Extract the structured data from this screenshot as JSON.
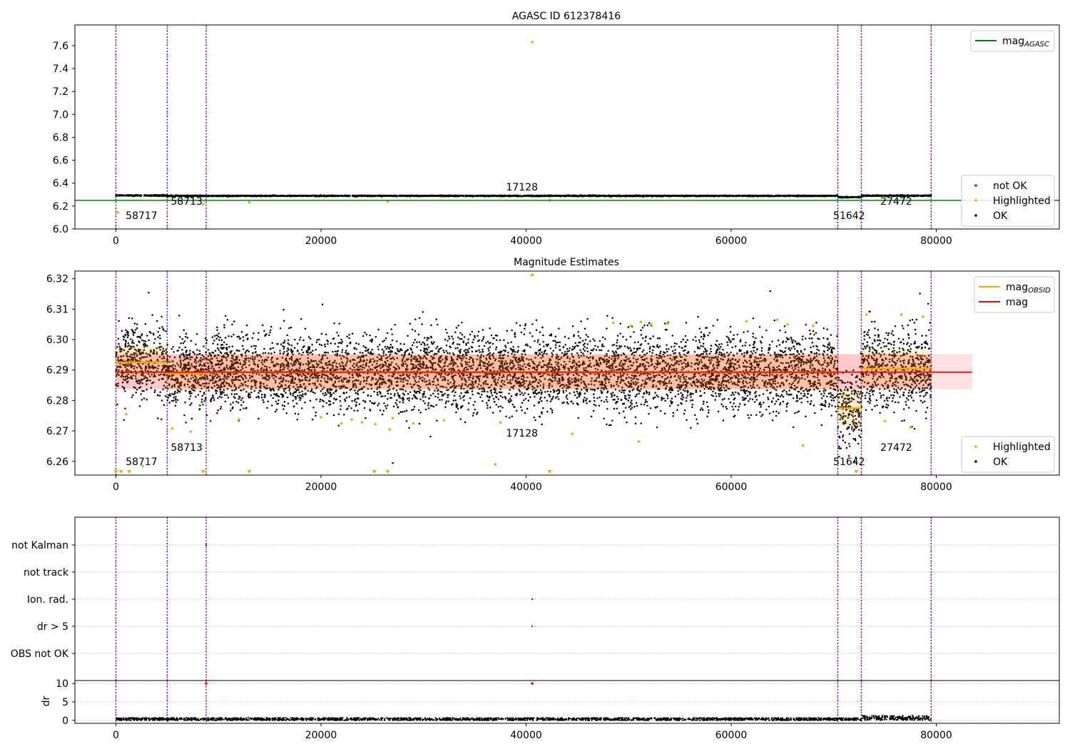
{
  "colors": {
    "ok": "#000000",
    "highlighted": "#ffa500",
    "not_ok": "#ff0000",
    "mag_agasc": "#008000",
    "mag_obsid": "#ffa500",
    "mag": "#ff0000",
    "obs_boundary": "#800080",
    "obs_boundary_alt": "#00008b"
  },
  "obs_boundaries": [
    0,
    5000,
    8800,
    70400,
    72700,
    79500
  ],
  "obsids": [
    {
      "label": "58717",
      "x": 2500
    },
    {
      "label": "58713",
      "x": 6900
    },
    {
      "label": "17128",
      "x": 39600
    },
    {
      "label": "51642",
      "x": 71500
    },
    {
      "label": "27472",
      "x": 76100
    }
  ],
  "chart_data": [
    {
      "type": "scatter",
      "title": "AGASC ID 612378416",
      "xlabel": "",
      "ylabel": "",
      "xlim": [
        -4000,
        92000
      ],
      "ylim": [
        6.0,
        7.78
      ],
      "xticks": [
        0,
        20000,
        40000,
        60000,
        80000
      ],
      "yticks": [
        6.0,
        6.2,
        6.4,
        6.6,
        6.8,
        7.0,
        7.2,
        7.4,
        7.6
      ],
      "legend_top": {
        "position": "top-right",
        "entries": [
          {
            "label": "mag",
            "sub": "AGASC",
            "kind": "line",
            "color": "#008000"
          }
        ]
      },
      "legend_bottom": {
        "position": "bottom-right",
        "entries": [
          {
            "label": "not OK",
            "kind": "dot",
            "color": "#ff0000"
          },
          {
            "label": "Highlighted",
            "kind": "dot",
            "color": "#ffa500"
          },
          {
            "label": "OK",
            "kind": "dot",
            "color": "#000000"
          }
        ]
      },
      "mag_agasc": 6.25,
      "ok_bands": [
        {
          "x": [
            0,
            5000
          ],
          "center": 6.2925,
          "spread": 0.004
        },
        {
          "x": [
            5000,
            8800
          ],
          "center": 6.289,
          "spread": 0.004
        },
        {
          "x": [
            8800,
            70400
          ],
          "center": 6.289,
          "spread": 0.0035
        },
        {
          "x": [
            70400,
            72700
          ],
          "center": 6.2775,
          "spread": 0.004
        },
        {
          "x": [
            72700,
            79500
          ],
          "center": 6.2905,
          "spread": 0.004
        }
      ],
      "highlighted_points": [
        [
          200,
          6.145
        ],
        [
          8500,
          6.215
        ],
        [
          13000,
          6.232
        ],
        [
          26500,
          6.238
        ],
        [
          42300,
          6.25
        ],
        [
          40600,
          7.63
        ]
      ]
    },
    {
      "type": "scatter",
      "title": "Magnitude Estimates",
      "xlabel": "",
      "ylabel": "",
      "xlim": [
        -4000,
        92000
      ],
      "ylim": [
        6.2555,
        6.3225
      ],
      "xticks": [
        0,
        20000,
        40000,
        60000,
        80000
      ],
      "yticks": [
        6.26,
        6.27,
        6.28,
        6.29,
        6.3,
        6.31,
        6.32
      ],
      "yticklabels": [
        "6.26",
        "6.27",
        "6.28",
        "6.29",
        "6.30",
        "6.31",
        "6.32"
      ],
      "legend_top": {
        "position": "top-right",
        "entries": [
          {
            "label": "mag",
            "sub": "OBSID",
            "kind": "line",
            "color": "#ffa500"
          },
          {
            "label": "mag",
            "kind": "line",
            "color": "#ff0000"
          }
        ]
      },
      "legend_bottom": {
        "position": "bottom-right",
        "entries": [
          {
            "label": "Highlighted",
            "kind": "dot",
            "color": "#ffa500"
          },
          {
            "label": "OK",
            "kind": "dot",
            "color": "#000000"
          }
        ]
      },
      "mag": 6.2893,
      "mag_band": [
        6.2837,
        6.2952
      ],
      "mag_band_x": [
        0,
        83500
      ],
      "mag_obsid": [
        {
          "x": [
            0,
            5000
          ],
          "value": 6.2925,
          "band": [
            6.287,
            6.298
          ]
        },
        {
          "x": [
            5000,
            8800
          ],
          "value": 6.2888,
          "band": [
            6.2835,
            6.294
          ]
        },
        {
          "x": [
            8800,
            70400
          ],
          "value": 6.2893,
          "band": [
            6.2837,
            6.295
          ]
        },
        {
          "x": [
            70400,
            72700
          ],
          "value": 6.2775,
          "band": [
            6.2715,
            6.2835
          ]
        },
        {
          "x": [
            72700,
            79500
          ],
          "value": 6.2905,
          "band": [
            6.2845,
            6.2962
          ]
        }
      ],
      "highlighted_points": [
        [
          1000,
          6.2755
        ],
        [
          5500,
          6.2708
        ],
        [
          7300,
          6.2698
        ],
        [
          12000,
          6.2738
        ],
        [
          20000,
          6.2745
        ],
        [
          22000,
          6.2725
        ],
        [
          23000,
          6.2738
        ],
        [
          24000,
          6.2728
        ],
        [
          25300,
          6.2722
        ],
        [
          26700,
          6.2705
        ],
        [
          27000,
          6.2742
        ],
        [
          29000,
          6.2725
        ],
        [
          32000,
          6.2735
        ],
        [
          37500,
          6.2728
        ],
        [
          37000,
          6.259
        ],
        [
          44500,
          6.269
        ],
        [
          51000,
          6.2665
        ],
        [
          67000,
          6.2652
        ],
        [
          75000,
          6.2732
        ],
        [
          77500,
          6.2712
        ],
        [
          2600,
          6.2585
        ],
        [
          48500,
          6.3055
        ],
        [
          50200,
          6.3045
        ],
        [
          51200,
          6.3058
        ],
        [
          52200,
          6.305
        ],
        [
          53800,
          6.3052
        ],
        [
          61500,
          6.306
        ],
        [
          64500,
          6.3065
        ],
        [
          65500,
          6.305
        ],
        [
          68000,
          6.3045
        ],
        [
          73200,
          6.3082
        ],
        [
          76600,
          6.3082
        ],
        [
          78700,
          6.3075
        ]
      ],
      "lower_markers": [
        0,
        500,
        1300,
        8500,
        13000,
        25200,
        26500,
        42300,
        72200
      ],
      "upper_markers": [
        40600
      ]
    },
    {
      "type": "scatter",
      "title": "",
      "xlabel": "",
      "ylabel": "",
      "xlim": [
        -4000,
        92000
      ],
      "categories": [
        "not Kalman",
        "not track",
        "Ion. rad.",
        "dr > 5",
        "OBS not OK"
      ],
      "flag_points": [
        {
          "category": "not Kalman",
          "x": 8800
        },
        {
          "category": "Ion. rad.",
          "x": 40600
        },
        {
          "category": "dr > 5",
          "x": 40600
        }
      ]
    },
    {
      "type": "scatter",
      "title": "",
      "xlabel": "",
      "ylabel": "dr",
      "xlim": [
        -4000,
        92000
      ],
      "ylim": [
        -0.8,
        10.8
      ],
      "xticks": [
        0,
        20000,
        40000,
        60000,
        80000
      ],
      "yticks": [
        0,
        5,
        10
      ],
      "ok_range": [
        [
          0,
          72700,
          0.0,
          0.7
        ],
        [
          72700,
          79500,
          0.0,
          1.3
        ]
      ],
      "not_ok_points": [
        [
          8800,
          10.0
        ],
        [
          40600,
          10.0
        ]
      ]
    }
  ],
  "xtick_labels": [
    "0",
    "20000",
    "40000",
    "60000",
    "80000"
  ],
  "ytick_labels_top": [
    "6.0",
    "6.2",
    "6.4",
    "6.6",
    "6.8",
    "7.0",
    "7.2",
    "7.4",
    "7.6"
  ],
  "ytick_labels_mid": [
    "6.26",
    "6.27",
    "6.28",
    "6.29",
    "6.30",
    "6.31",
    "6.32"
  ],
  "ytick_labels_dr": [
    "0",
    "5",
    "10"
  ]
}
